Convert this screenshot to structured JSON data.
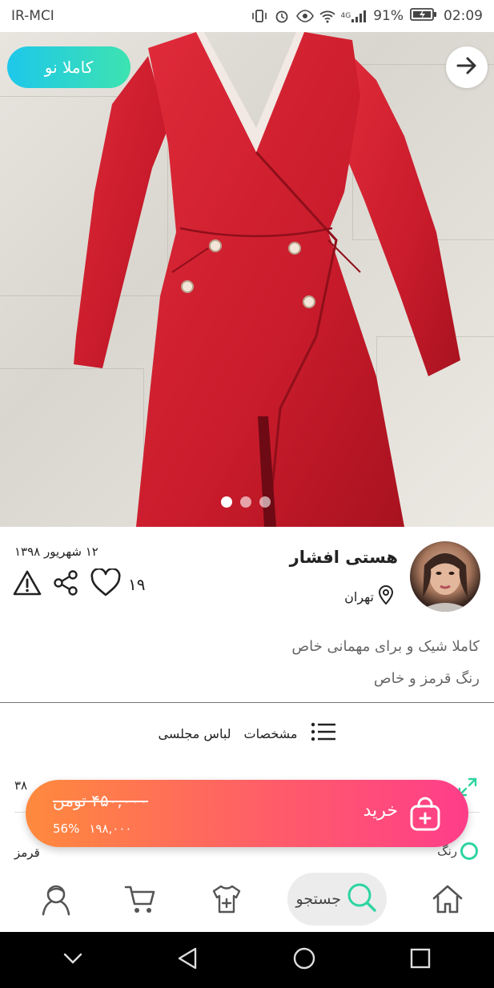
{
  "status_bar": {
    "carrier": "IR-MCI",
    "battery": "91%",
    "time": "02:09",
    "network": "4G"
  },
  "product": {
    "condition_badge": "کاملا نو",
    "image_count": 3,
    "active_image": 1
  },
  "seller": {
    "name": "هستی افشار",
    "location": "تهران",
    "date": "۱۲ شهریور ۱۳۹۸",
    "likes": "۱۹"
  },
  "description": {
    "line1": "کاملا شیک و برای مهمانی خاص",
    "line2": "رنگ قرمز و خاص"
  },
  "category": {
    "specs_label": "مشخصات",
    "category_name": "لباس مجلسی"
  },
  "specs": {
    "size_value": "۳۸",
    "color_label": "رنگ",
    "color_value": "قرمز"
  },
  "buy": {
    "label": "خرید",
    "old_price": "۴۵۰,۰۰۰ تومن",
    "discount": "56%",
    "new_price": "۱۹۸,۰۰۰"
  },
  "bottom_nav": {
    "search_label": "جستجو"
  },
  "colors": {
    "accent_teal": "#2dd4a0",
    "buy_gradient_start": "#ff8a3d",
    "buy_gradient_end": "#ff3d8a",
    "dress_red": "#d81e2e"
  }
}
